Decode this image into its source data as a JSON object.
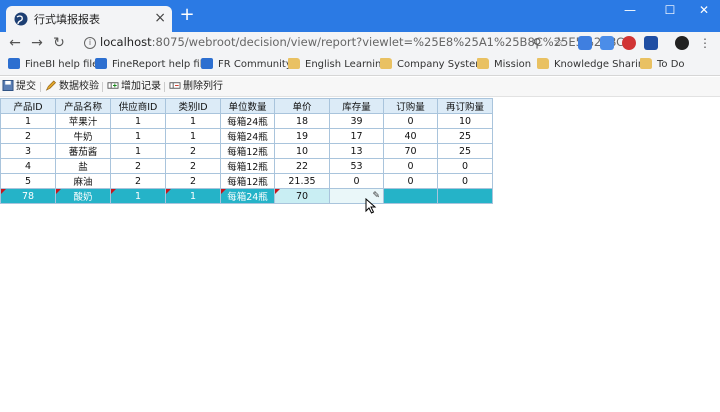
{
  "browser": {
    "tab_title": "行式填报报表",
    "tab_close": "×",
    "new_tab": "+",
    "window_controls": {
      "minimize": "—",
      "maximize": "☐",
      "close": "✕"
    },
    "url_host": "localhost",
    "url_path": ":8075/webroot/decision/view/report?viewlet=%25E8%25A1%25B8C%25E5%25BC...",
    "bookmarks": [
      {
        "label": "FineBI help file",
        "icon": "fr-icon"
      },
      {
        "label": "FineReport help file",
        "icon": "fr-icon"
      },
      {
        "label": "FR Community",
        "icon": "fr-icon"
      },
      {
        "label": "English Learning",
        "icon": "folder-icon"
      },
      {
        "label": "Company System",
        "icon": "folder-icon"
      },
      {
        "label": "Mission",
        "icon": "folder-icon"
      },
      {
        "label": "Knowledge Sharing",
        "icon": "folder-icon"
      },
      {
        "label": "To Do",
        "icon": "folder-icon"
      }
    ]
  },
  "toolbar": {
    "submit": "提交",
    "validate": "数据校验",
    "add_record": "增加记录",
    "delete_row": "删除列行"
  },
  "table": {
    "headers": [
      "产品ID",
      "产品名称",
      "供应商ID",
      "类别ID",
      "单位数量",
      "单价",
      "库存量",
      "订购量",
      "再订购量"
    ],
    "rows": [
      [
        "1",
        "苹果汁",
        "1",
        "1",
        "每箱24瓶",
        "18",
        "39",
        "0",
        "10"
      ],
      [
        "2",
        "牛奶",
        "1",
        "1",
        "每箱24瓶",
        "19",
        "17",
        "40",
        "25"
      ],
      [
        "3",
        "蕃茄酱",
        "1",
        "2",
        "每箱12瓶",
        "10",
        "13",
        "70",
        "25"
      ],
      [
        "4",
        "盐",
        "2",
        "2",
        "每箱12瓶",
        "22",
        "53",
        "0",
        "0"
      ],
      [
        "5",
        "麻油",
        "2",
        "2",
        "每箱12瓶",
        "21.35",
        "0",
        "0",
        "0"
      ],
      [
        "78",
        "酸奶",
        "1",
        "1",
        "每箱24瓶",
        "70",
        "",
        "",
        ""
      ]
    ]
  },
  "colors": {
    "titlebar": "#2b7ae4",
    "header": "#dcebf7",
    "selected_row": "#25b3c8",
    "flag": "#c8151b"
  }
}
